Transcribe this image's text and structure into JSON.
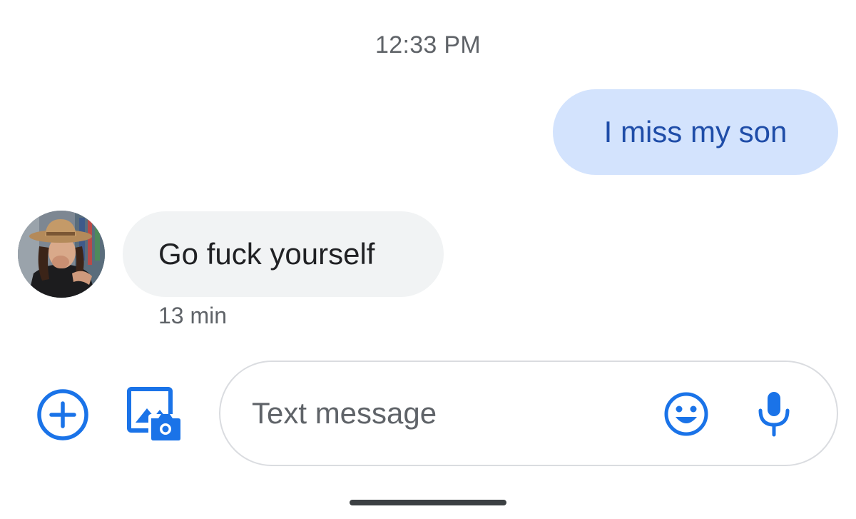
{
  "conversation": {
    "header_time": "12:33 PM",
    "messages": [
      {
        "direction": "sent",
        "text": "I miss my son"
      },
      {
        "direction": "received",
        "text": "Go fuck yourself",
        "time": "13 min"
      }
    ]
  },
  "composer": {
    "placeholder": "Text message",
    "value": "",
    "icons": {
      "add": "plus-circle-icon",
      "gallery": "gallery-camera-icon",
      "emoji": "smiley-face-icon",
      "mic": "microphone-icon"
    }
  },
  "colors": {
    "accent": "#1a73e8",
    "sent_bubble_bg": "#d3e3fd",
    "sent_text": "#1f4da8",
    "received_bubble_bg": "#f1f3f4",
    "secondary_text": "#5f6368"
  }
}
